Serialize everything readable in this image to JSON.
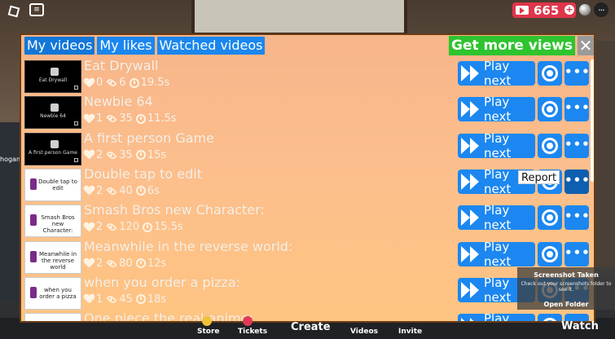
{
  "topbar": {
    "currency_amount": "665",
    "currency_icon": "video-camera-icon",
    "menu_glyph": "···",
    "chat_glyph": "≡"
  },
  "tabs": [
    {
      "label": "My videos"
    },
    {
      "label": "My likes"
    },
    {
      "label": "Watched videos"
    }
  ],
  "get_more_label": "Get more views",
  "close_label": "✕",
  "rows": [
    {
      "title": "Eat Drywall",
      "likes": "0",
      "views": "6",
      "duration": "19.5s",
      "thumb_text": "Eat Drywall",
      "thumb_style": "dark"
    },
    {
      "title": "Newbie 64",
      "likes": "1",
      "views": "35",
      "duration": "11.5s",
      "thumb_text": "Newbie 64",
      "thumb_style": "dark"
    },
    {
      "title": "A first person Game",
      "likes": "2",
      "views": "35",
      "duration": "15s",
      "thumb_text": "A first person Game",
      "thumb_style": "dark"
    },
    {
      "title": "Double tap to edit",
      "likes": "2",
      "views": "40",
      "duration": "6s",
      "thumb_text": "Double tap to edit",
      "thumb_style": "white"
    },
    {
      "title": "Smash Bros new Character:",
      "likes": "2",
      "views": "120",
      "duration": "15.5s",
      "thumb_text": "Smash Bros new Character:",
      "thumb_style": "white"
    },
    {
      "title": "Meanwhile in the reverse world:",
      "likes": "2",
      "views": "80",
      "duration": "12s",
      "thumb_text": "Meanwhile in the reverse world",
      "thumb_style": "white"
    },
    {
      "title": "when you order a pizza:",
      "likes": "1",
      "views": "45",
      "duration": "18s",
      "thumb_text": "when you order a pizza",
      "thumb_style": "white"
    },
    {
      "title": "One piece the real anime:",
      "likes": "",
      "views": "",
      "duration": "",
      "thumb_text": "",
      "thumb_style": "white"
    }
  ],
  "play_label": "Play next",
  "more_label": "•••",
  "tooltip_label": "Report",
  "toast": {
    "heading": "Screenshot Taken",
    "subtext": "Check out your screenshots folder to see it.",
    "action": "Open Folder"
  },
  "bottom_bar": {
    "store": "Store",
    "tickets": "Tickets",
    "create": "Create",
    "videos": "Videos",
    "invite": "Invite",
    "watch": "Watch"
  },
  "side_text": "hogan",
  "colors": {
    "panel_top": "#f7b58a",
    "tab_blue": "#1b87ee",
    "get_more_green": "#2ec42e",
    "currency_red": "#e0354a"
  }
}
